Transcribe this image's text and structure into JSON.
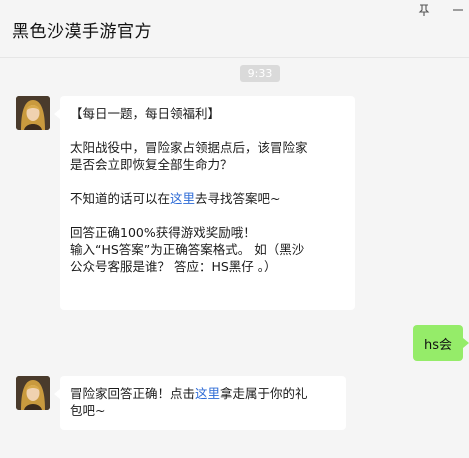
{
  "window": {
    "title": "黑色沙漠手游官方",
    "pin_icon": "pin-icon",
    "minimize_icon": "minimize-icon"
  },
  "chat": {
    "timestamp": "9:33",
    "messages": [
      {
        "sender": "official",
        "avatar_icon": "avatar-icon",
        "header": "【每日一题，每日领福利】",
        "question_line1": "太阳战役中，冒险家占领据点后，该冒险家",
        "question_line2": "是否会立即恢复全部生命力？",
        "hint_before": "不知道的话可以在",
        "hint_link": "这里",
        "hint_after": "去寻找答案吧~",
        "reward_line": "回答正确100%获得游戏奖励哦！",
        "format_line1": "输入“HS答案”为正确答案格式。 如（黑沙",
        "format_line2": "公众号客服是谁？ 答应：HS黑仔 。）"
      },
      {
        "sender": "user",
        "text": "hs会"
      },
      {
        "sender": "official",
        "avatar_icon": "avatar-icon",
        "line1_before": "冒险家回答正确！点击",
        "line1_link": "这里",
        "line1_after": "拿走属于你的礼",
        "line2": "包吧~"
      }
    ]
  },
  "colors": {
    "background": "#f5f5f5",
    "bubble_incoming": "#ffffff",
    "bubble_outgoing": "#95ec69",
    "link": "#2e6bd6",
    "timestamp_bg": "#dadada"
  }
}
